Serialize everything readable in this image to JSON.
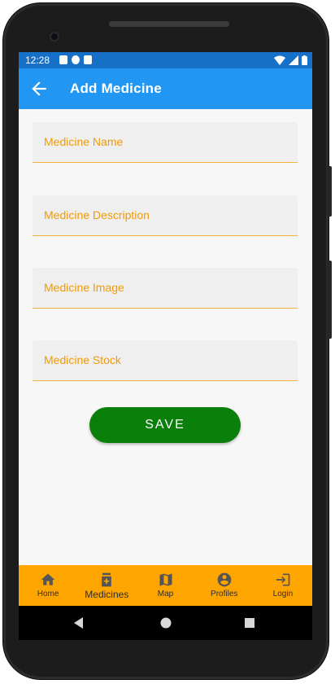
{
  "status_bar": {
    "time": "12:28",
    "left_icons": [
      "notification-icon",
      "data-saver-icon",
      "sim-card-icon"
    ],
    "right_icons": [
      "wifi-icon",
      "signal-icon",
      "battery-icon"
    ]
  },
  "app_bar": {
    "back_icon": "arrow-back-icon",
    "title": "Add Medicine",
    "color": "#2196f3"
  },
  "form": {
    "fields": [
      {
        "label": "Medicine Name",
        "value": ""
      },
      {
        "label": "Medicine Description",
        "value": ""
      },
      {
        "label": "Medicine Image",
        "value": ""
      },
      {
        "label": "Medicine Stock",
        "value": ""
      }
    ],
    "label_color": "#f29a00",
    "save_label": "SAVE",
    "save_color": "#0a800a"
  },
  "bottom_nav": {
    "background": "#ffa500",
    "active_index": 1,
    "items": [
      {
        "label": "Home",
        "icon": "home-icon"
      },
      {
        "label": "Medicines",
        "icon": "medicine-bottle-icon"
      },
      {
        "label": "Map",
        "icon": "map-icon"
      },
      {
        "label": "Profiles",
        "icon": "account-circle-icon"
      },
      {
        "label": "Login",
        "icon": "login-icon"
      }
    ]
  },
  "system_nav": [
    "back-triangle-icon",
    "home-circle-icon",
    "recents-square-icon"
  ]
}
